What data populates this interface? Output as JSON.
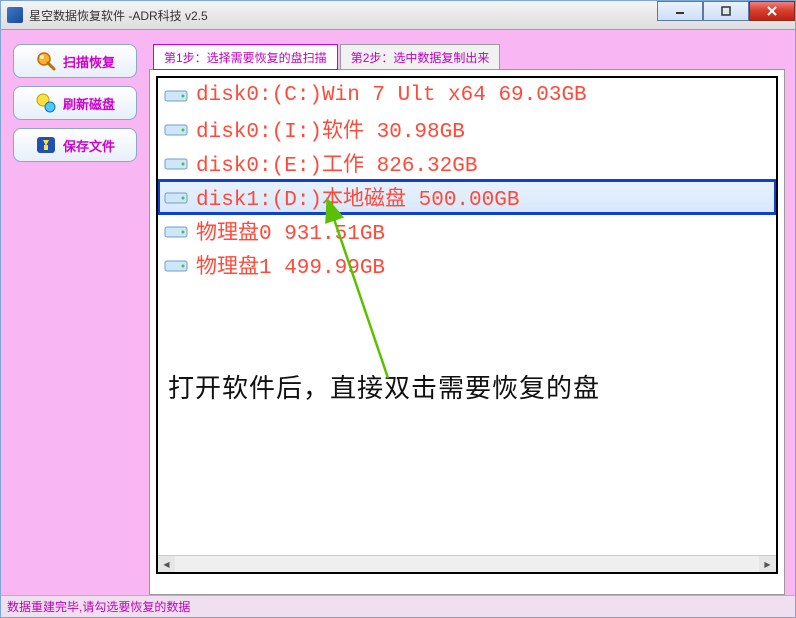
{
  "window": {
    "title": "星空数据恢复软件   -ADR科技 v2.5"
  },
  "sidebar": {
    "buttons": [
      {
        "label": "扫描恢复"
      },
      {
        "label": "刷新磁盘"
      },
      {
        "label": "保存文件"
      }
    ]
  },
  "tabs": [
    {
      "label": "第1步：选择需要恢复的盘扫描",
      "active": true
    },
    {
      "label": "第2步：选中数据复制出来",
      "active": false
    }
  ],
  "disks": [
    {
      "text": "disk0:(C:)Win 7 Ult x64 69.03GB",
      "selected": false
    },
    {
      "text": "disk0:(I:)软件 30.98GB",
      "selected": false
    },
    {
      "text": "disk0:(E:)工作 826.32GB",
      "selected": false
    },
    {
      "text": "disk1:(D:)本地磁盘 500.00GB",
      "selected": true
    },
    {
      "text": "物理盘0 931.51GB",
      "selected": false
    },
    {
      "text": "物理盘1 499.99GB",
      "selected": false
    }
  ],
  "instruction": "打开软件后，直接双击需要恢复的盘",
  "statusbar": "数据重建完毕,请勾选要恢复的数据"
}
